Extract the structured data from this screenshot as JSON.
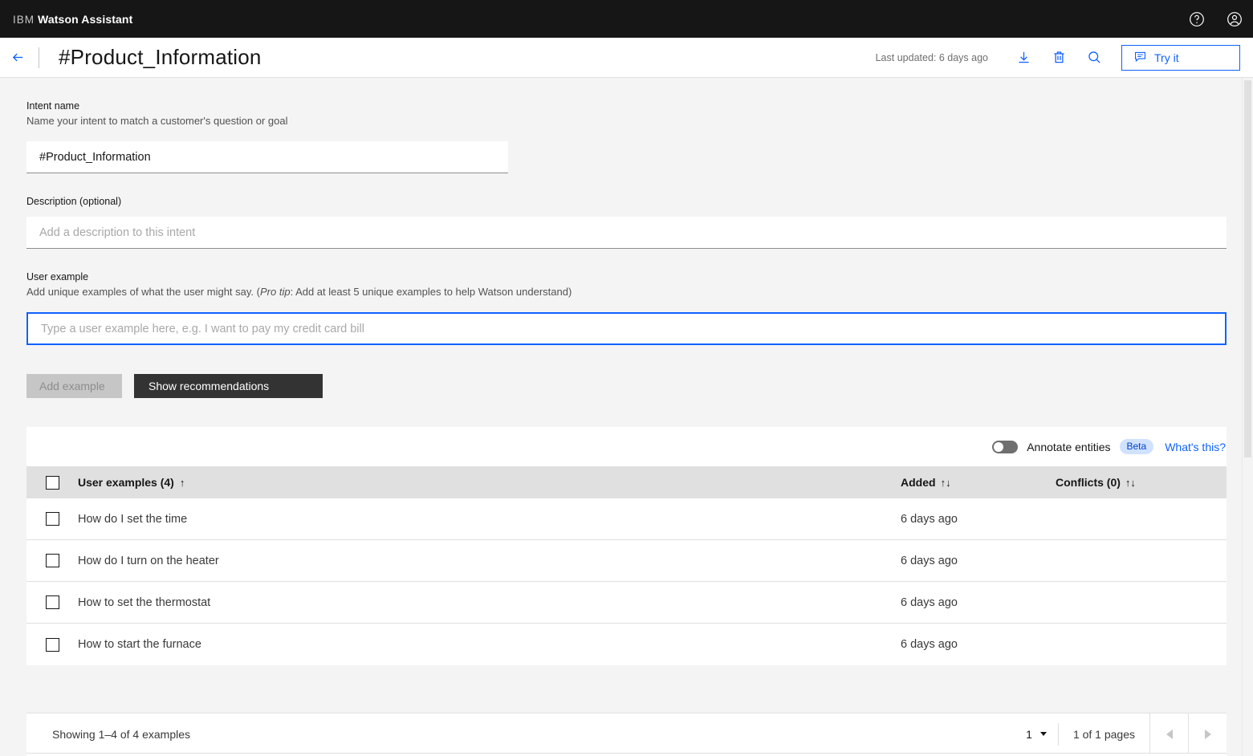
{
  "topbar": {
    "brand_ibm": "IBM",
    "brand_product": "Watson Assistant",
    "help_icon": "help-circle-icon",
    "account_icon": "user-avatar-icon"
  },
  "subheader": {
    "back_icon": "arrow-left-icon",
    "title": "#Product_Information",
    "last_updated": "Last updated: 6 days ago",
    "download_icon": "download-icon",
    "delete_icon": "trash-icon",
    "search_icon": "search-icon",
    "try_it_label": "Try it",
    "try_it_icon": "chat-icon",
    "accent_color": "#0f62fe"
  },
  "form": {
    "intent_name_label": "Intent name",
    "intent_name_help": "Name your intent to match a customer's question or goal",
    "intent_name_value": "#Product_Information",
    "description_label": "Description (optional)",
    "description_value": "",
    "description_placeholder": "Add a description to this intent",
    "user_example_label": "User example",
    "user_example_help_before": "Add unique examples of what the user might say. (",
    "user_example_help_italic": "Pro tip",
    "user_example_help_after": ": Add at least 5 unique examples to help Watson understand)",
    "user_example_value": "",
    "user_example_placeholder": "Type a user example here, e.g. I want to pay my credit card bill",
    "add_example_label": "Add example",
    "show_recommendations_label": "Show recommendations"
  },
  "table": {
    "annotate_label": "Annotate entities",
    "annotate_enabled": false,
    "beta_badge": "Beta",
    "whats_this_label": "What's this?",
    "columns": {
      "examples": "User examples (4)",
      "examples_sort": "↑",
      "added": "Added",
      "added_sort": "↑↓",
      "conflicts": "Conflicts (0)",
      "conflicts_sort": "↑↓"
    },
    "rows": [
      {
        "example": "How do I set the time",
        "added": "6 days ago",
        "conflicts": ""
      },
      {
        "example": "How do I turn on the heater",
        "added": "6 days ago",
        "conflicts": ""
      },
      {
        "example": "How to set the thermostat",
        "added": "6 days ago",
        "conflicts": ""
      },
      {
        "example": "How to start the furnace",
        "added": "6 days ago",
        "conflicts": ""
      }
    ]
  },
  "pagination": {
    "showing": "Showing 1–4 of 4 examples",
    "page_number": "1",
    "pages_text": "1 of 1 pages",
    "prev_icon": "caret-left-icon",
    "next_icon": "caret-right-icon"
  }
}
